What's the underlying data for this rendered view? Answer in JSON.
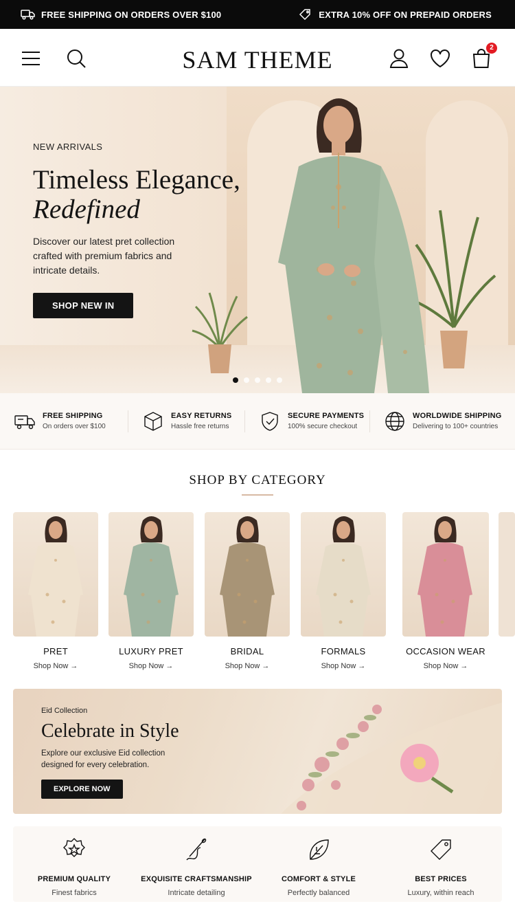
{
  "announcement": {
    "left": "FREE SHIPPING ON ORDERS OVER $100",
    "right": "EXTRA 10% OFF ON PREPAID ORDERS",
    "left_icon": "truck-icon",
    "right_icon": "tag-icon"
  },
  "header": {
    "logo": "SAM THEME",
    "cart_count": "2",
    "icons": [
      "menu-icon",
      "search-icon",
      "account-icon",
      "wishlist-icon",
      "cart-icon"
    ]
  },
  "hero": {
    "eyebrow": "NEW ARRIVALS",
    "title_line1": "Timeless Elegance,",
    "title_line2": "Redefined",
    "description": "Discover our latest pret collection crafted with premium fabrics and intricate details.",
    "cta": "SHOP NEW IN",
    "slides": 5,
    "active_slide": 1
  },
  "features": [
    {
      "icon": "delivery-truck-icon",
      "title": "FREE SHIPPING",
      "subtitle": "On orders over $100"
    },
    {
      "icon": "box-icon",
      "title": "EASY RETURNS",
      "subtitle": "Hassle free returns"
    },
    {
      "icon": "shield-check-icon",
      "title": "SECURE PAYMENTS",
      "subtitle": "100% secure checkout"
    },
    {
      "icon": "globe-icon",
      "title": "WORLDWIDE SHIPPING",
      "subtitle": "Delivering to 100+ countries"
    }
  ],
  "categories": {
    "title": "SHOP BY CATEGORY",
    "items": [
      {
        "name": "PRET",
        "link": "Shop Now →",
        "color": "#efe2cf"
      },
      {
        "name": "LUXURY PRET",
        "link": "Shop Now →",
        "color": "#9fb5a2"
      },
      {
        "name": "BRIDAL",
        "link": "Shop Now →",
        "color": "#a89476"
      },
      {
        "name": "FORMALS",
        "link": "Shop Now →",
        "color": "#e6dcc8"
      },
      {
        "name": "OCCASION WEAR",
        "link": "Shop Now →",
        "color": "#d98e98"
      }
    ]
  },
  "promo": {
    "eyebrow": "Eid Collection",
    "title": "Celebrate in Style",
    "description": "Explore our exclusive Eid collection designed for every celebration.",
    "cta": "EXPLORE NOW"
  },
  "values": [
    {
      "icon": "star-badge-icon",
      "title": "PREMIUM QUALITY",
      "subtitle": "Finest fabrics"
    },
    {
      "icon": "needle-thread-icon",
      "title": "EXQUISITE CRAFTSMANSHIP",
      "subtitle": "Intricate detailing"
    },
    {
      "icon": "leaf-icon",
      "title": "COMFORT & STYLE",
      "subtitle": "Perfectly balanced"
    },
    {
      "icon": "price-tag-icon",
      "title": "BEST PRICES",
      "subtitle": "Luxury, within reach"
    }
  ]
}
